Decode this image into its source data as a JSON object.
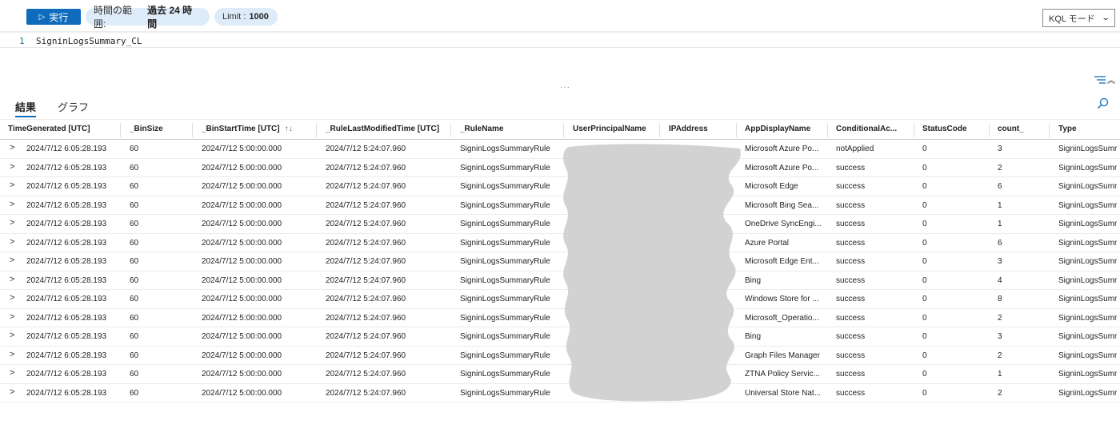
{
  "toolbar": {
    "run_label": "実行",
    "time_range_label": "時間の範囲:",
    "time_range_value": "過去 24 時間",
    "limit_label": "Limit :",
    "limit_value": "1000",
    "mode_select": "KQL モード"
  },
  "editor": {
    "line_number": "1",
    "query": "SigninLogsSummary_CL"
  },
  "splitter": "···",
  "tabs": {
    "results": "結果",
    "chart": "グラフ"
  },
  "table": {
    "columns": [
      "TimeGenerated [UTC]",
      "_BinSize",
      "_BinStartTime [UTC]",
      "_RuleLastModifiedTime [UTC]",
      "_RuleName",
      "UserPrincipalName",
      "IPAddress",
      "AppDisplayName",
      "ConditionalAc...",
      "StatusCode",
      "count_",
      "Type"
    ],
    "sort_indicator": "↑↓",
    "expander_glyph": ">",
    "rows": [
      [
        "2024/7/12 6:05:28.193",
        "60",
        "2024/7/12 5:00:00.000",
        "2024/7/12 5:24:07.960",
        "SigninLogsSummaryRule",
        "",
        "",
        "Microsoft Azure Po...",
        "notApplied",
        "0",
        "3",
        "SigninLogsSumr"
      ],
      [
        "2024/7/12 6:05:28.193",
        "60",
        "2024/7/12 5:00:00.000",
        "2024/7/12 5:24:07.960",
        "SigninLogsSummaryRule",
        "",
        "",
        "Microsoft Azure Po...",
        "success",
        "0",
        "2",
        "SigninLogsSumr"
      ],
      [
        "2024/7/12 6:05:28.193",
        "60",
        "2024/7/12 5:00:00.000",
        "2024/7/12 5:24:07.960",
        "SigninLogsSummaryRule",
        "",
        "",
        "Microsoft Edge",
        "success",
        "0",
        "6",
        "SigninLogsSumr"
      ],
      [
        "2024/7/12 6:05:28.193",
        "60",
        "2024/7/12 5:00:00.000",
        "2024/7/12 5:24:07.960",
        "SigninLogsSummaryRule",
        "",
        "",
        "Microsoft Bing Sea...",
        "success",
        "0",
        "1",
        "SigninLogsSumr"
      ],
      [
        "2024/7/12 6:05:28.193",
        "60",
        "2024/7/12 5:00:00.000",
        "2024/7/12 5:24:07.960",
        "SigninLogsSummaryRule",
        "",
        "",
        "OneDrive SyncEngi...",
        "success",
        "0",
        "1",
        "SigninLogsSumr"
      ],
      [
        "2024/7/12 6:05:28.193",
        "60",
        "2024/7/12 5:00:00.000",
        "2024/7/12 5:24:07.960",
        "SigninLogsSummaryRule",
        "",
        "",
        "Azure Portal",
        "success",
        "0",
        "6",
        "SigninLogsSumr"
      ],
      [
        "2024/7/12 6:05:28.193",
        "60",
        "2024/7/12 5:00:00.000",
        "2024/7/12 5:24:07.960",
        "SigninLogsSummaryRule",
        "",
        "",
        "Microsoft Edge Ent...",
        "success",
        "0",
        "3",
        "SigninLogsSumr"
      ],
      [
        "2024/7/12 6:05:28.193",
        "60",
        "2024/7/12 5:00:00.000",
        "2024/7/12 5:24:07.960",
        "SigninLogsSummaryRule",
        "",
        "",
        "Bing",
        "success",
        "0",
        "4",
        "SigninLogsSumr"
      ],
      [
        "2024/7/12 6:05:28.193",
        "60",
        "2024/7/12 5:00:00.000",
        "2024/7/12 5:24:07.960",
        "SigninLogsSummaryRule",
        "",
        "",
        "Windows Store for ...",
        "success",
        "0",
        "8",
        "SigninLogsSumr"
      ],
      [
        "2024/7/12 6:05:28.193",
        "60",
        "2024/7/12 5:00:00.000",
        "2024/7/12 5:24:07.960",
        "SigninLogsSummaryRule",
        "",
        "",
        "Microsoft_Operatio...",
        "success",
        "0",
        "2",
        "SigninLogsSumr"
      ],
      [
        "2024/7/12 6:05:28.193",
        "60",
        "2024/7/12 5:00:00.000",
        "2024/7/12 5:24:07.960",
        "SigninLogsSummaryRule",
        "",
        "",
        "Bing",
        "success",
        "0",
        "3",
        "SigninLogsSumr"
      ],
      [
        "2024/7/12 6:05:28.193",
        "60",
        "2024/7/12 5:00:00.000",
        "2024/7/12 5:24:07.960",
        "SigninLogsSummaryRule",
        "",
        "",
        "Graph Files Manager",
        "success",
        "0",
        "2",
        "SigninLogsSumr"
      ],
      [
        "2024/7/12 6:05:28.193",
        "60",
        "2024/7/12 5:00:00.000",
        "2024/7/12 5:24:07.960",
        "SigninLogsSummaryRule",
        "",
        "",
        "ZTNA Policy Servic...",
        "success",
        "0",
        "1",
        "SigninLogsSumr"
      ],
      [
        "2024/7/12 6:05:28.193",
        "60",
        "2024/7/12 5:00:00.000",
        "2024/7/12 5:24:07.960",
        "SigninLogsSummaryRule",
        "",
        "",
        "Universal Store Nat...",
        "success",
        "0",
        "2",
        "SigninLogsSumr"
      ]
    ]
  },
  "colors": {
    "accent": "#0f6cbd",
    "pill_bg": "#deecf9",
    "redaction": "#d2d2d2"
  }
}
